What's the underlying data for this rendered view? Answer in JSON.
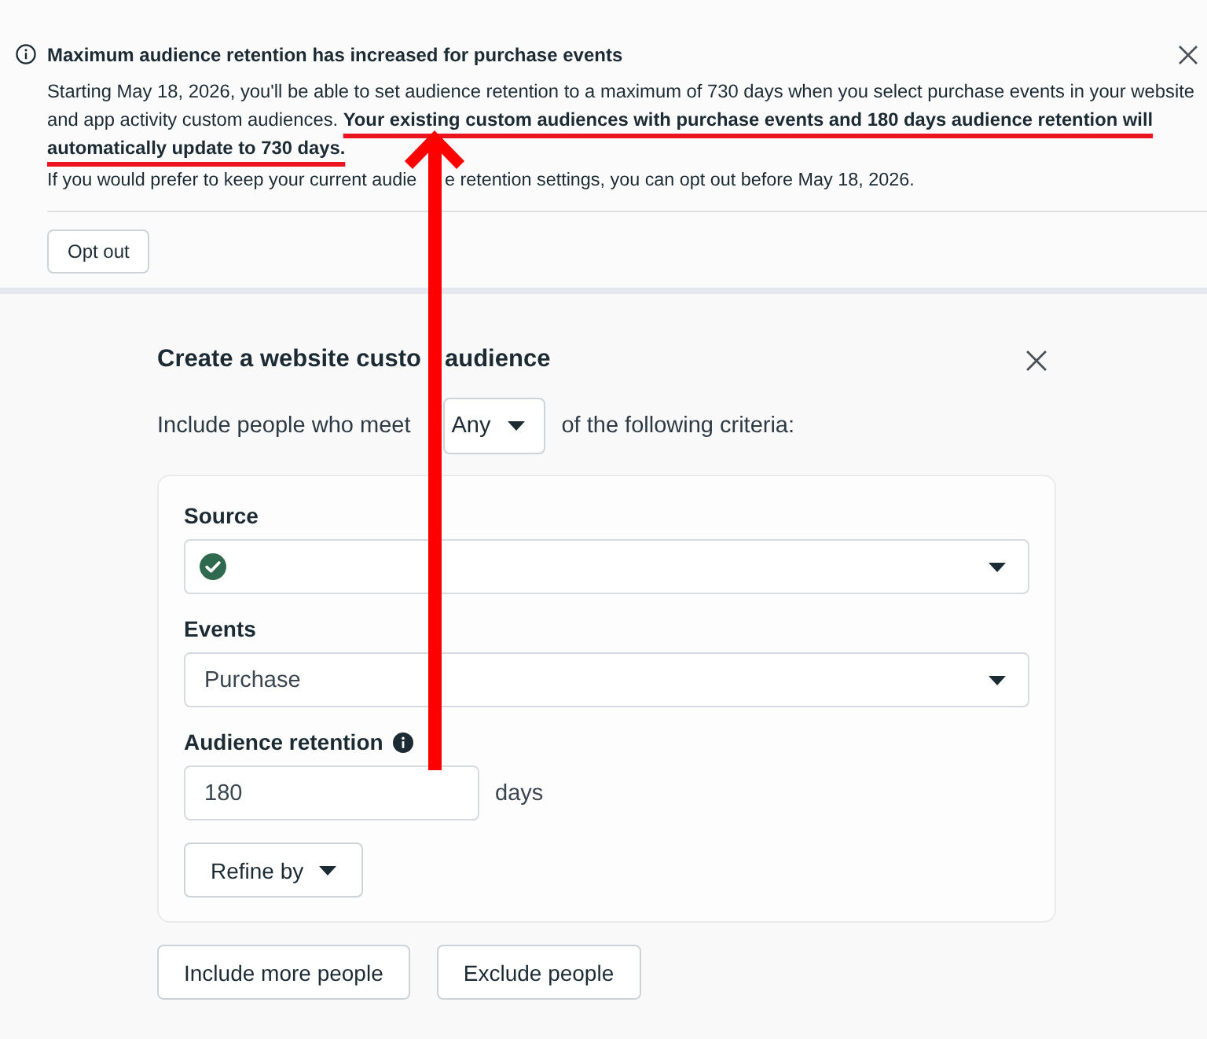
{
  "notice": {
    "title": "Maximum audience retention has increased for purchase events",
    "body": "Starting May 18, 2026, you'll be able to set audience retention to a maximum of 730 days when you select purchase events in your website and app activity custom audiences. **Your existing custom audiences with purchase events and 180 days audience retention will automatically update to 730 days.**",
    "note_parts": [
      "If you would prefer to keep your current audie",
      "e retention settings, you can opt out before May 18, 2026."
    ],
    "button": "Opt out"
  },
  "dialog": {
    "title_parts": [
      "Create a website custo",
      "audience"
    ],
    "criteria": {
      "prefix": "Include people who meet",
      "match": "Any",
      "suffix": "of the following criteria:"
    },
    "rule": {
      "fields": [
        {
          "kind": "select",
          "label": "Source",
          "verified": true
        },
        {
          "kind": "select",
          "label": "Events",
          "value": "Purchase"
        },
        {
          "kind": "number",
          "label": "Audience retention",
          "info": true,
          "value": "180",
          "unit": "days"
        }
      ],
      "refine": "Refine by"
    },
    "buttons": [
      "Include more people",
      "Exclude people"
    ]
  }
}
